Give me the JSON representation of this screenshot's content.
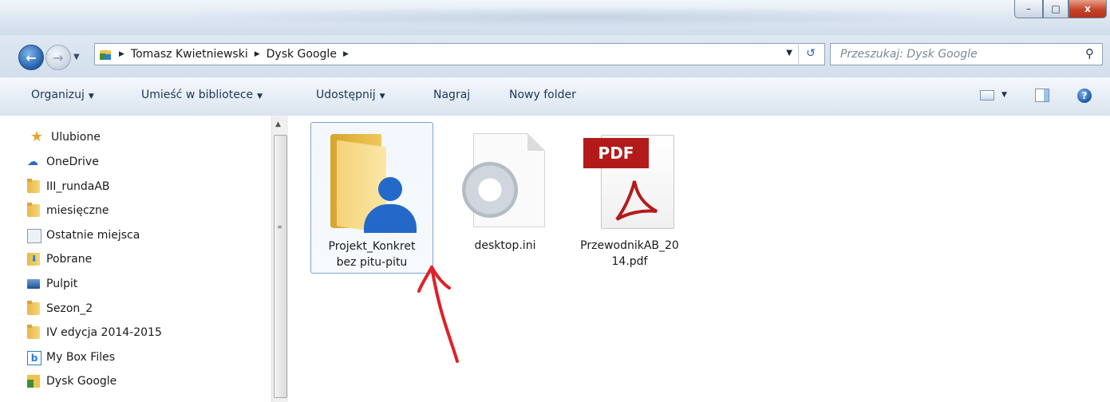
{
  "window": {
    "controls": {
      "minimize": "–",
      "maximize": "□",
      "close": "x"
    }
  },
  "address": {
    "crumbs": [
      "Tomasz Kwietniewski",
      "Dysk Google"
    ],
    "search_placeholder": "Przeszukaj: Dysk Google"
  },
  "commandbar": {
    "organize": "Organizuj",
    "include_in_library": "Umieść w bibliotece",
    "share": "Udostępnij",
    "burn": "Nagraj",
    "new_folder": "Nowy folder",
    "help": "?"
  },
  "navigation": {
    "favorites": "Ulubione",
    "items": [
      {
        "label": "OneDrive",
        "icon": "onedrive-icon"
      },
      {
        "label": "III_rundaAB",
        "icon": "folder-icon"
      },
      {
        "label": "miesięczne",
        "icon": "folder-icon"
      },
      {
        "label": "Ostatnie miejsca",
        "icon": "recent-places-icon"
      },
      {
        "label": "Pobrane",
        "icon": "downloads-icon"
      },
      {
        "label": "Pulpit",
        "icon": "desktop-icon"
      },
      {
        "label": "Sezon_2",
        "icon": "folder-icon"
      },
      {
        "label": "IV edycja 2014-2015",
        "icon": "folder-icon"
      },
      {
        "label": "My Box Files",
        "icon": "box-icon"
      },
      {
        "label": "Dysk Google",
        "icon": "google-drive-icon"
      }
    ]
  },
  "files": [
    {
      "label_line1": "Projekt_Konkret",
      "label_line2": "bez pitu-pitu",
      "type": "shared-folder",
      "selected": true
    },
    {
      "label_line1": "desktop.ini",
      "label_line2": "",
      "type": "settings-file",
      "selected": false
    },
    {
      "label_line1": "PrzewodnikAB_20",
      "label_line2": "14.pdf",
      "type": "pdf",
      "selected": false,
      "badge": "PDF"
    }
  ],
  "annotation": {
    "color": "#e0202a",
    "icon": "red-arrow-annotation"
  }
}
